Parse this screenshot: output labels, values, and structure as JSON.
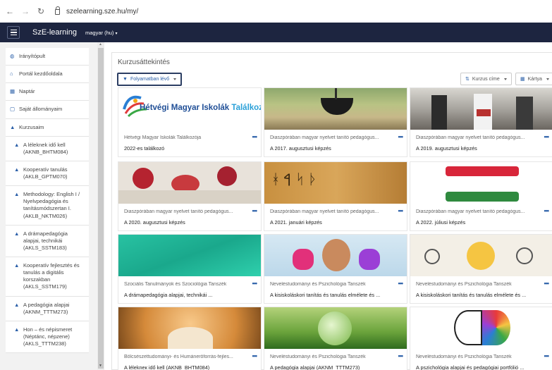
{
  "browser": {
    "url": "szelearning.sze.hu/my/"
  },
  "navbar": {
    "brand": "SzE-learning",
    "language": "magyar (hu)"
  },
  "sidebar": {
    "items": [
      {
        "icon": "dashboard-icon",
        "glyph": "◍",
        "label": "Irányítópult"
      },
      {
        "icon": "home-icon",
        "glyph": "⌂",
        "label": "Portál kezdőoldala"
      },
      {
        "icon": "calendar-icon",
        "glyph": "▦",
        "label": "Naptár"
      },
      {
        "icon": "file-icon",
        "glyph": "▢",
        "label": "Saját állományaim"
      },
      {
        "icon": "graduation-cap-icon",
        "glyph": "▲",
        "label": "Kurzusaim"
      },
      {
        "icon": "graduation-cap-icon",
        "glyph": "▲",
        "label": "A léleknek idő kell (AKNB_BHTM084)",
        "sub": true
      },
      {
        "icon": "graduation-cap-icon",
        "glyph": "▲",
        "label": "Kooperatív tanulás (AKLB_GPTM070)",
        "sub": true
      },
      {
        "icon": "graduation-cap-icon",
        "glyph": "▲",
        "label": "Methodology: English I / Nyelvpedagógia és tanításmódszertan I. (AKLB_NKTM026)",
        "sub": true
      },
      {
        "icon": "graduation-cap-icon",
        "glyph": "▲",
        "label": "A drámapedagógia alapjai, technikái (AKLS_SSTM183)",
        "sub": true
      },
      {
        "icon": "graduation-cap-icon",
        "glyph": "▲",
        "label": "Kooperatív fejlesztés és tanulás a digitális korszakban (AKLS_SSTM179)",
        "sub": true
      },
      {
        "icon": "graduation-cap-icon",
        "glyph": "▲",
        "label": "A pedagógia alapjai (AKNM_TTTM273)",
        "sub": true
      },
      {
        "icon": "graduation-cap-icon",
        "glyph": "▲",
        "label": "Hon – és népismeret (Néptánc, népzene) (AKLS_TTTM238)",
        "sub": true
      }
    ]
  },
  "main": {
    "title": "Kurzusáttekintés",
    "filter_label": "Folyamatban lévő",
    "sort_label": "Kurzus címe",
    "view_label": "Kártya",
    "more_glyph": "•••",
    "hetvegi_logo_main": "Hétvégi Magyar Iskolák",
    "hetvegi_logo_accent": "Találkozó"
  },
  "courses": [
    {
      "category": "Hétvégi Magyar Iskolák Találkozója",
      "name": "2022-es találkozó"
    },
    {
      "category": "Diaszpórában magyar nyelvet tanító pedagógus...",
      "name": "A 2017. augusztusi képzés"
    },
    {
      "category": "Diaszpórában magyar nyelvet tanító pedagógus...",
      "name": "A 2019. augusztusi képzés"
    },
    {
      "category": "Diaszpórában magyar nyelvet tanító pedagógus...",
      "name": "A 2020. augusztusi képzés"
    },
    {
      "category": "Diaszpórában magyar nyelvet tanító pedagógus...",
      "name": "A 2021. januári képzés"
    },
    {
      "category": "Diaszpórában magyar nyelvet tanító pedagógus...",
      "name": "A 2022. júliusi képzés"
    },
    {
      "category": "Szociális Tanulmányok és Szociológia Tanszék",
      "name": "A drámapedagógia alapjai, technikái ..."
    },
    {
      "category": "Neveléstudományi és Pszichológia Tanszék",
      "name": "A kisiskoláskori tanítás és tanulás elmélete és ..."
    },
    {
      "category": "Neveléstudományi és Pszichológia Tanszék",
      "name": "A kisiskoláskori tanítás és tanulás elmélete és ..."
    },
    {
      "category": "Bölcsészettudományi- és Humánerőforrás-fejles...",
      "name": "A lélekneк idő kell (AKNB_BHTM084)"
    },
    {
      "category": "Neveléstudományi és Pszichológia Tanszék",
      "name": "A pedagógia alapjai (AKNM_TTTM273)"
    },
    {
      "category": "Neveléstudományi és Pszichológia Tanszék",
      "name": "A pszichológia alapjai és pedagógiai portfólió ..."
    }
  ]
}
